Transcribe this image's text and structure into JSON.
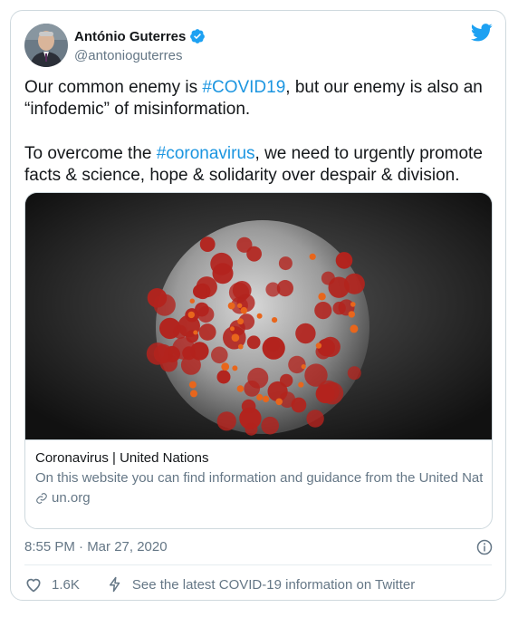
{
  "author": {
    "name": "António Guterres",
    "handle": "@antonioguterres"
  },
  "tweet": {
    "p1_before": "Our common enemy is ",
    "p1_tag": "#COVID19",
    "p1_after": ", but our enemy is also an “infodemic” of misinformation.",
    "p2_before": "To overcome the ",
    "p2_tag": "#coronavirus",
    "p2_after": ", we need to urgently promote facts & science, hope & solidarity over despair & division."
  },
  "link_card": {
    "title": "Coronavirus | United Nations",
    "description": "On this website you can find information and guidance from the United Nations regarding the current outbreak of coronavirus disease (COVID…",
    "domain": "un.org"
  },
  "timestamp": "8:55 PM · Mar 27, 2020",
  "actions": {
    "likes": "1.6K",
    "covid_link": "See the latest COVID-19 information on Twitter"
  },
  "icons": {
    "verified": "verified-badge-icon",
    "logo": "twitter-bird-icon",
    "info": "info-icon",
    "like": "heart-icon",
    "covid": "lightning-bolt-icon",
    "domain": "link-icon"
  },
  "colors": {
    "accent": "#1b95e0",
    "secondary_text": "#657786",
    "border": "#cfd9de"
  }
}
